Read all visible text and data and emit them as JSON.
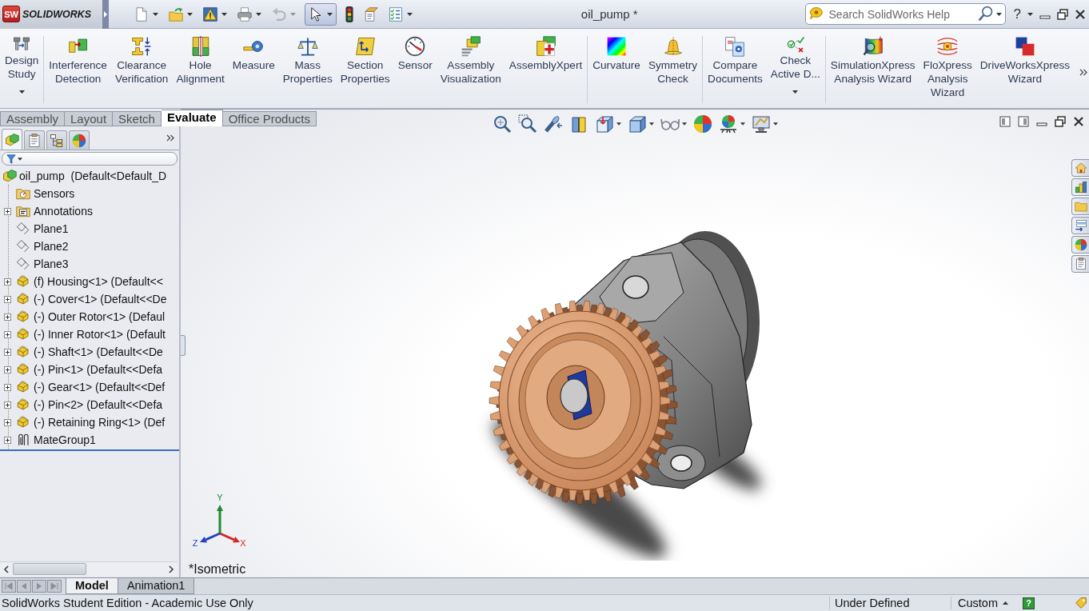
{
  "window": {
    "badge": "SW",
    "wordmark": "SOLIDWORKS",
    "title": "oil_pump *",
    "help": "?"
  },
  "quick_access": [
    {
      "kind": "new",
      "dropdown": true,
      "disabled": false,
      "pressed": false
    },
    {
      "kind": "open",
      "dropdown": true,
      "disabled": false,
      "pressed": false
    },
    {
      "kind": "warning",
      "dropdown": true,
      "disabled": false,
      "pressed": false
    },
    {
      "kind": "print",
      "dropdown": true,
      "disabled": false,
      "pressed": false
    },
    {
      "kind": "undo",
      "dropdown": true,
      "disabled": true,
      "pressed": false
    },
    {
      "kind": "select",
      "dropdown": true,
      "disabled": false,
      "pressed": true
    },
    {
      "kind": "rebuild",
      "dropdown": false,
      "disabled": false,
      "pressed": false
    },
    {
      "kind": "properties",
      "dropdown": false,
      "disabled": false,
      "pressed": false
    },
    {
      "kind": "options",
      "dropdown": true,
      "disabled": false,
      "pressed": false
    }
  ],
  "search": {
    "placeholder": "Search SolidWorks Help"
  },
  "ribbon": {
    "groups": [
      {
        "items": [
          {
            "label": "Design\nStudy",
            "kind": "design-study",
            "dropdown": true
          }
        ]
      },
      {
        "items": [
          {
            "label": "Interference\nDetection",
            "kind": "interference",
            "dropdown": false
          },
          {
            "label": "Clearance\nVerification",
            "kind": "clearance",
            "dropdown": false
          },
          {
            "label": "Hole\nAlignment",
            "kind": "hole-alignment",
            "dropdown": false
          },
          {
            "label": "Measure",
            "kind": "measure",
            "dropdown": false
          },
          {
            "label": "Mass\nProperties",
            "kind": "mass-properties",
            "dropdown": false
          },
          {
            "label": "Section\nProperties",
            "kind": "section-properties",
            "dropdown": false
          },
          {
            "label": "Sensor",
            "kind": "sensor",
            "dropdown": false
          },
          {
            "label": "Assembly\nVisualization",
            "kind": "assembly-visualization",
            "dropdown": false
          },
          {
            "label": "AssemblyXpert",
            "kind": "assemblyxpert",
            "dropdown": false
          }
        ]
      },
      {
        "items": [
          {
            "label": "Curvature",
            "kind": "curvature",
            "dropdown": false
          },
          {
            "label": "Symmetry\nCheck",
            "kind": "symmetry-check",
            "dropdown": false
          }
        ]
      },
      {
        "items": [
          {
            "label": "Compare\nDocuments",
            "kind": "compare-documents",
            "dropdown": false
          },
          {
            "label": "Check\nActive D...",
            "kind": "check-active",
            "dropdown": true
          }
        ]
      },
      {
        "items": [
          {
            "label": "SimulationXpress\nAnalysis Wizard",
            "kind": "simulationxpress",
            "dropdown": false
          },
          {
            "label": "FloXpress\nAnalysis\nWizard",
            "kind": "floxpress",
            "dropdown": false
          },
          {
            "label": "DriveWorksXpress\nWizard",
            "kind": "driveworksxpress",
            "dropdown": false
          }
        ]
      }
    ]
  },
  "command_tabs": [
    {
      "label": "Assembly",
      "selected": false
    },
    {
      "label": "Layout",
      "selected": false
    },
    {
      "label": "Sketch",
      "selected": false
    },
    {
      "label": "Evaluate",
      "selected": true
    },
    {
      "label": "Office Products",
      "selected": false
    }
  ],
  "panel_tabs": [
    {
      "kind": "features",
      "selected": true
    },
    {
      "kind": "properties",
      "selected": false
    },
    {
      "kind": "configurations",
      "selected": false
    },
    {
      "kind": "appearances",
      "selected": false
    }
  ],
  "tree": [
    {
      "label": "oil_pump  (Default<Default_D",
      "kind": "assembly",
      "children": [
        {
          "label": "Sensors",
          "kind": "sensors"
        },
        {
          "label": "Annotations",
          "kind": "annotations",
          "expanded": false
        },
        {
          "label": "Plane1",
          "kind": "plane"
        },
        {
          "label": "Plane2",
          "kind": "plane"
        },
        {
          "label": "Plane3",
          "kind": "plane"
        },
        {
          "label": "(f) Housing<1> (Default<<",
          "kind": "part",
          "expanded": false
        },
        {
          "label": "(-) Cover<1> (Default<<De",
          "kind": "part",
          "expanded": false
        },
        {
          "label": "(-) Outer Rotor<1> (Defaul",
          "kind": "part",
          "expanded": false
        },
        {
          "label": "(-) Inner Rotor<1> (Default",
          "kind": "part",
          "expanded": false
        },
        {
          "label": "(-) Shaft<1> (Default<<De",
          "kind": "part",
          "expanded": false
        },
        {
          "label": "(-) Pin<1> (Default<<Defa",
          "kind": "part",
          "expanded": false
        },
        {
          "label": "(-) Gear<1> (Default<<Def",
          "kind": "part",
          "expanded": false
        },
        {
          "label": "(-) Pin<2> (Default<<Defa",
          "kind": "part",
          "expanded": false
        },
        {
          "label": "(-) Retaining Ring<1> (Def",
          "kind": "part",
          "expanded": false
        },
        {
          "label": "MateGroup1",
          "kind": "mates",
          "expanded": false
        }
      ]
    }
  ],
  "viewport": {
    "view_label": "*Isometric",
    "axes": [
      {
        "kind": "x",
        "label": "X"
      },
      {
        "kind": "y",
        "label": "Y"
      },
      {
        "kind": "z",
        "label": "Z"
      }
    ]
  },
  "bottom_tabs": [
    {
      "label": "Model",
      "selected": true
    },
    {
      "label": "Animation1",
      "selected": false
    }
  ],
  "status_bar": {
    "message": "SolidWorks Student Edition - Academic Use Only",
    "state": "Under Defined",
    "units": "Custom",
    "help": "?"
  }
}
